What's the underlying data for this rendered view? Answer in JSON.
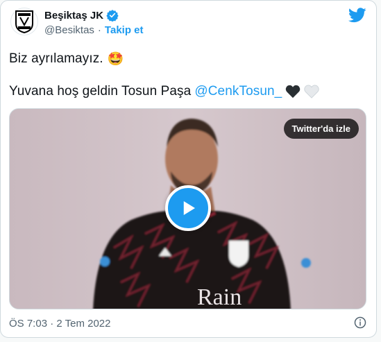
{
  "tweet": {
    "author_name": "Beşiktaş JK",
    "handle": "@Besiktas",
    "separator": "·",
    "follow_label": "Takip et",
    "line1_text": "Biz ayrılamayız.",
    "line1_emoji": "🤩",
    "line2_text": "Yuvana hoş geldin Tosun Paşa",
    "line2_mention": "@CenkTosun_",
    "timestamp": "ÖS 7:03 · 2 Tem 2022"
  },
  "media": {
    "watch_label": "Twitter'da izle",
    "jersey_sponsor": "Rain"
  },
  "icons": {
    "verified": "verified-badge-icon",
    "brand": "twitter-bird-icon",
    "play": "play-icon",
    "info": "info-icon",
    "heart_black": "black-heart-icon",
    "heart_white": "white-heart-icon"
  },
  "colors": {
    "accent": "#1d9bf0",
    "text": "#0f1419",
    "muted": "#536471"
  }
}
